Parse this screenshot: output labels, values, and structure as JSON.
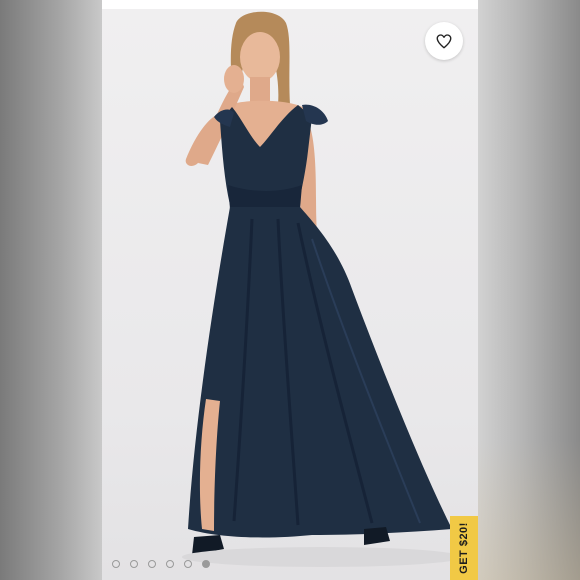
{
  "product_image": {
    "subject": "navy-blue-maxi-dress-photo",
    "dress_color": "#1f2f43",
    "background_color": "#ecebec"
  },
  "like_button": {
    "icon": "heart-outline-icon"
  },
  "carousel": {
    "total": 6,
    "active_index": 6
  },
  "promo_tab": {
    "label": "GET $20!",
    "color": "#f1c945"
  }
}
